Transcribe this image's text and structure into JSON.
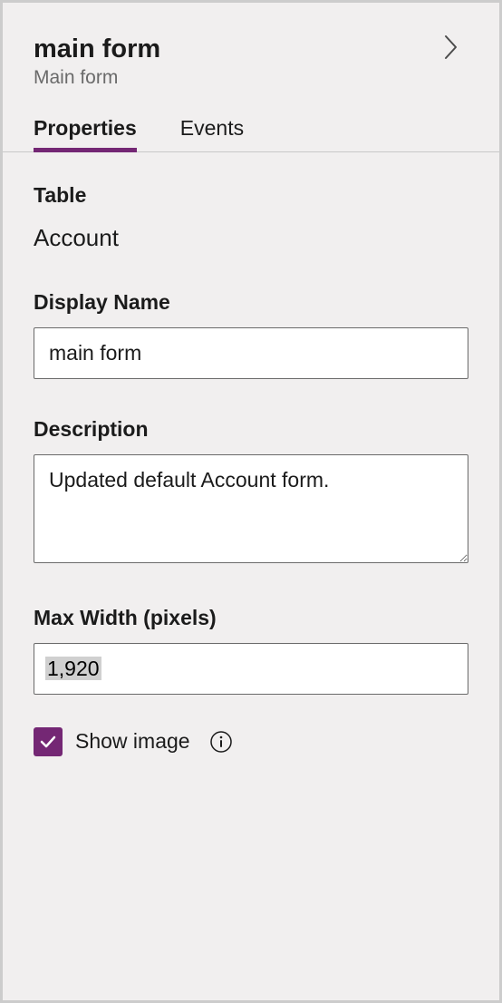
{
  "header": {
    "title": "main form",
    "subtitle": "Main form"
  },
  "tabs": [
    {
      "label": "Properties",
      "active": true
    },
    {
      "label": "Events",
      "active": false
    }
  ],
  "table": {
    "label": "Table",
    "value": "Account"
  },
  "display_name": {
    "label": "Display Name",
    "value": "main form"
  },
  "description": {
    "label": "Description",
    "value": "Updated default Account form."
  },
  "max_width": {
    "label": "Max Width (pixels)",
    "value": "1,920"
  },
  "show_image": {
    "label": "Show image",
    "checked": true
  },
  "colors": {
    "accent": "#742774"
  }
}
